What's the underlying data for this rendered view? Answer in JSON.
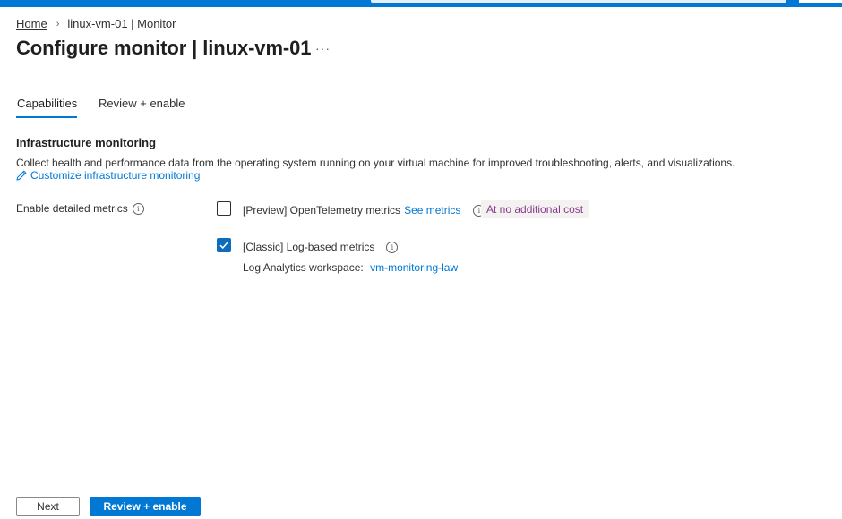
{
  "breadcrumb": {
    "home": "Home",
    "current": "linux-vm-01 | Monitor"
  },
  "page": {
    "title": "Configure monitor | linux-vm-01",
    "more": "···"
  },
  "tabs": [
    {
      "label": "Capabilities",
      "active": true
    },
    {
      "label": "Review + enable",
      "active": false
    }
  ],
  "section": {
    "title": "Infrastructure monitoring",
    "description": "Collect health and performance data from the operating system running on your virtual machine for improved troubleshooting, alerts, and visualizations.",
    "customize_link": "Customize infrastructure monitoring"
  },
  "metrics": {
    "label": "Enable detailed metrics",
    "options": [
      {
        "label": "[Preview] OpenTelemetry metrics",
        "link": "See metrics",
        "badge": "At no additional cost",
        "checked": false
      },
      {
        "label": "[Classic] Log-based metrics",
        "checked": true,
        "workspace_label": "Log Analytics workspace:",
        "workspace_value": "vm-monitoring-law"
      }
    ]
  },
  "footer": {
    "next": "Next",
    "review": "Review + enable"
  },
  "colors": {
    "accent": "#0078d4",
    "badge_text": "#8a3a8e",
    "badge_bg": "#f3f2f1"
  }
}
